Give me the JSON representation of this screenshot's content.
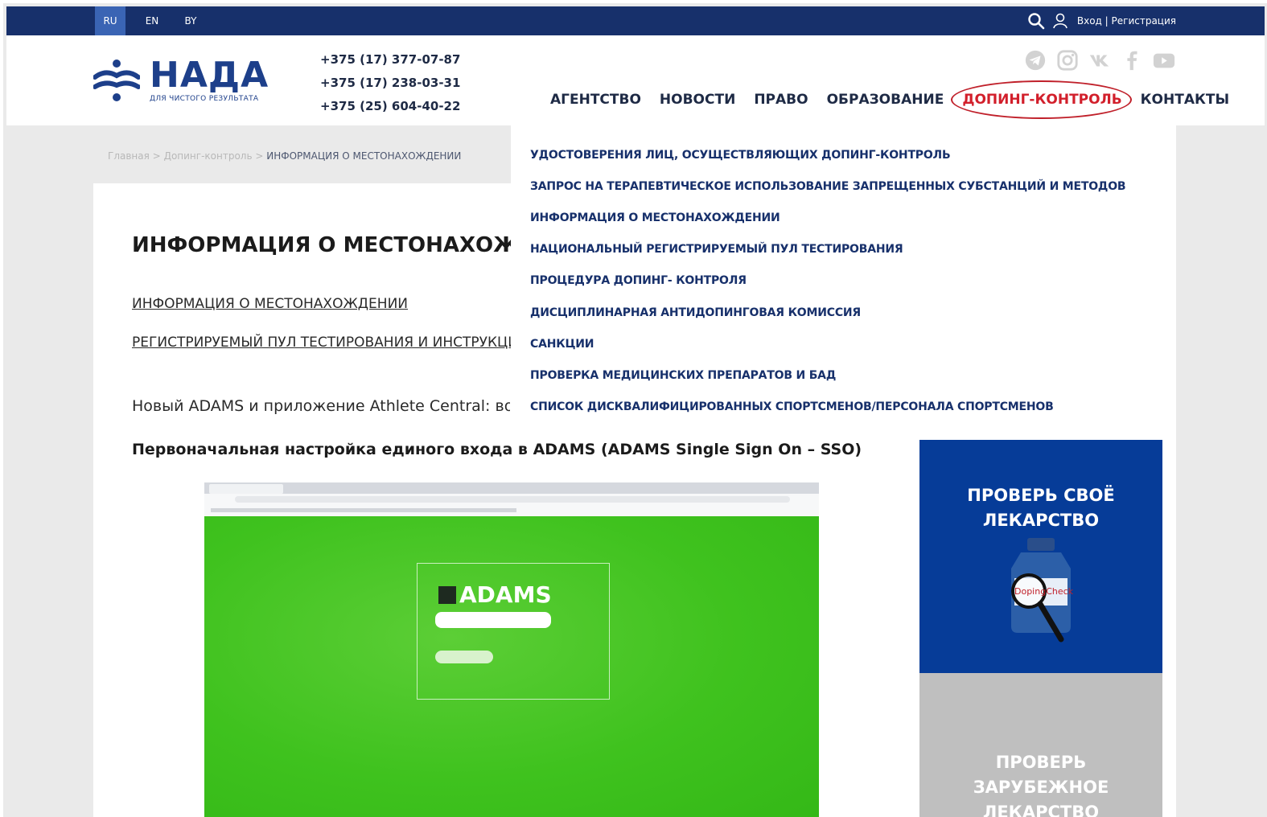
{
  "topbar": {
    "languages": [
      "RU",
      "EN",
      "BY"
    ],
    "active_language": "RU",
    "login_text": "Вход | Регистрация",
    "icons": [
      "search-icon",
      "user-icon"
    ]
  },
  "header": {
    "logo_text": "НАДА",
    "logo_subtext": "ДЛЯ ЧИСТОГО РЕЗУЛЬТАТА",
    "phones": [
      "+375 (17) 377-07-87",
      "+375 (17) 238-03-31",
      "+375 (25) 604-40-22"
    ],
    "social_icons": [
      "telegram-icon",
      "instagram-icon",
      "vk-icon",
      "facebook-icon",
      "youtube-icon"
    ],
    "nav": [
      {
        "label": "АГЕНТСТВО",
        "active": false
      },
      {
        "label": "НОВОСТИ",
        "active": false
      },
      {
        "label": "ПРАВО",
        "active": false
      },
      {
        "label": "ОБРАЗОВАНИЕ",
        "active": false
      },
      {
        "label": "ДОПИНГ-КОНТРОЛЬ",
        "active": true
      },
      {
        "label": "КОНТАКТЫ",
        "active": false
      }
    ]
  },
  "dropdown": {
    "items": [
      "УДОСТОВЕРЕНИЯ ЛИЦ, ОСУЩЕСТВЛЯЮЩИХ ДОПИНГ-КОНТРОЛЬ",
      "ЗАПРОС НА ТЕРАПЕВТИЧЕСКОЕ ИСПОЛЬЗОВАНИЕ ЗАПРЕЩЕННЫХ СУБСТАНЦИЙ И МЕТОДОВ",
      "ИНФОРМАЦИЯ О МЕСТОНАХОЖДЕНИИ",
      "НАЦИОНАЛЬНЫЙ РЕГИСТРИРУЕМЫЙ ПУЛ ТЕСТИРОВАНИЯ",
      "ПРОЦЕДУРА ДОПИНГ- КОНТРОЛЯ",
      "ДИСЦИПЛИНАРНАЯ АНТИДОПИНГОВАЯ КОМИССИЯ",
      "САНКЦИИ",
      "ПРОВЕРКА МЕДИЦИНСКИХ ПРЕПАРАТОВ И БАД",
      "СПИСОК ДИСКВАЛИФИЦИРОВАННЫХ СПОРТСМЕНОВ/ПЕРСОНАЛА СПОРТСМЕНОВ"
    ]
  },
  "breadcrumb": {
    "home": "Главная",
    "section": "Допинг-контроль",
    "separator": ">",
    "current": "ИНФОРМАЦИЯ О МЕСТОНАХОЖДЕНИИ"
  },
  "main": {
    "title": "ИНФОРМАЦИЯ О МЕСТОНАХОЖДЕНИ",
    "links": [
      "ИНФОРМАЦИЯ О МЕСТОНАХОЖДЕНИИ",
      "РЕГИСТРИРУЕМЫЙ ПУЛ ТЕСТИРОВАНИЯ И ИНСТРУКЦИЯ"
    ],
    "paragraph": "Новый ADAMS и приложение Athlete Central: вопр",
    "bold_paragraph": "Первоначальная настройка единого входа в ADAMS (ADAMS Single Sign On – SSO)",
    "screenshot_logo": "ADAMS"
  },
  "sidebar": {
    "promo1": "ПРОВЕРЬ СВОЁ ЛЕКАРСТВО",
    "promo1_lines": [
      "ПРОВЕРЬ СВОЁ",
      "ЛЕКАРСТВО"
    ],
    "promo2_lines": [
      "ПРОВЕРЬ",
      "ЗАРУБЕЖНОЕ",
      "ЛЕКАРСТВО"
    ],
    "bottle_label": "DopingCheck"
  },
  "colors": {
    "topbar": "#17306b",
    "accent_red": "#d21f2b",
    "brand_blue": "#1d3f8a",
    "promo_blue": "#063c98",
    "promo_gray": "#bfbfbf"
  }
}
